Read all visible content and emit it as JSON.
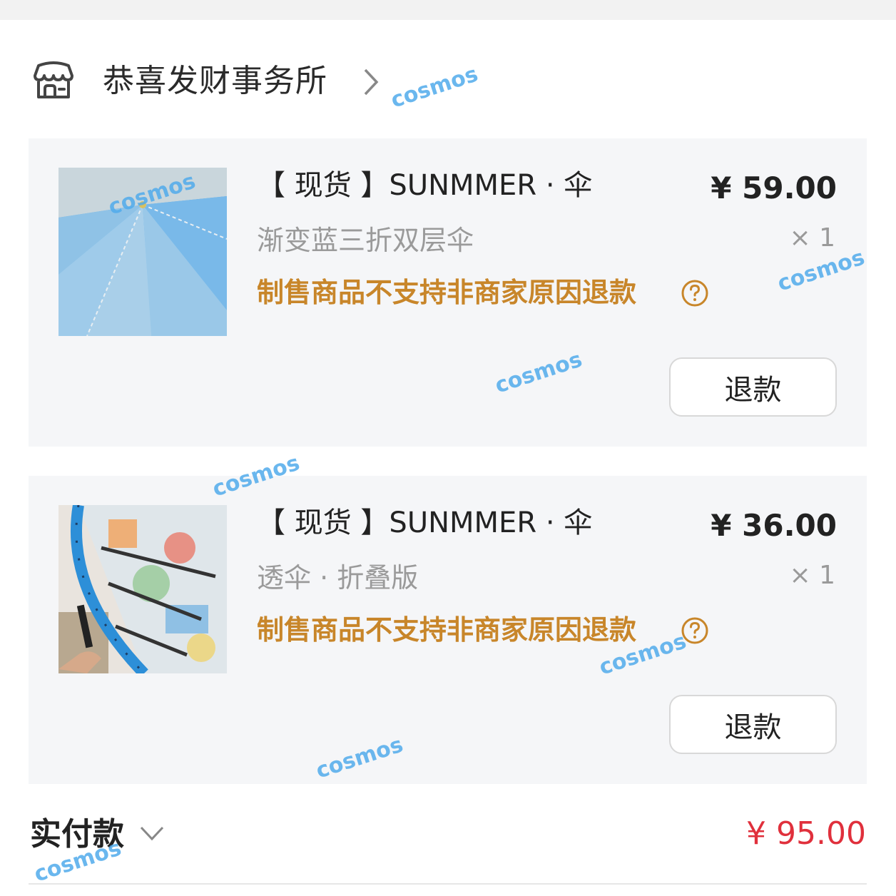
{
  "shop": {
    "name": "恭喜发财事务所",
    "icon": "store-icon"
  },
  "items": [
    {
      "title": "【 现货 】SUNMMER · 伞",
      "spec": "渐变蓝三折双层伞",
      "notice": "制售商品不支持非商家原因退款",
      "price": "¥ 59.00",
      "qty": "× 1",
      "refund_label": "退款",
      "thumb_desc": "blue-gradient-umbrella"
    },
    {
      "title": "【 现货 】SUNMMER · 伞",
      "spec": "透伞 · 折叠版",
      "notice": "制售商品不支持非商家原因退款",
      "price": "¥ 36.00",
      "qty": "× 1",
      "refund_label": "退款",
      "thumb_desc": "transparent-folding-umbrella"
    }
  ],
  "payment": {
    "label": "实付款",
    "amount": "¥ 95.00"
  },
  "watermark": "cosmos",
  "colors": {
    "notice": "#c8862a",
    "amount": "#e0303c",
    "card_bg": "#f5f6f8"
  }
}
